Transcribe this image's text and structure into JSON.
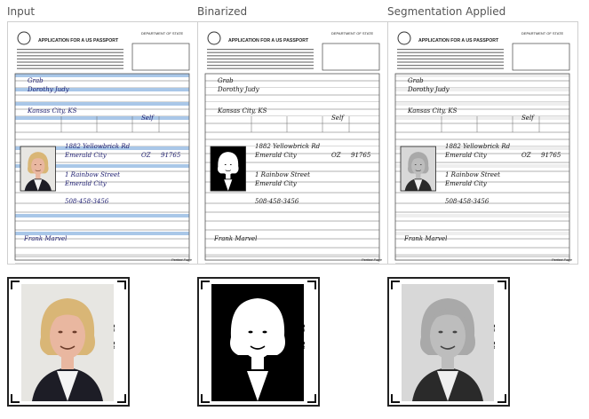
{
  "panels": [
    {
      "title": "Input",
      "mode": "input"
    },
    {
      "title": "Binarized",
      "mode": "binarized"
    },
    {
      "title": "Segmentation Applied",
      "mode": "segmented"
    }
  ],
  "form": {
    "header": "APPLICATION FOR A US PASSPORT",
    "department": "DEPARTMENT OF STATE",
    "surname": "Grab",
    "given_name": "Dorothy Judy",
    "birth_city": "Kansas City, KS",
    "occupation": "Self",
    "address_line": "1882 Yellowbrick Rd",
    "city": "Emerald City",
    "state": "OZ",
    "zip": "91765",
    "permanent_address": "1 Rainbow Street",
    "permanent_city": "Emerald City",
    "phone": "508-458-3456",
    "emergency_contact": "Frank Marvel",
    "footer": "Perfect Page"
  },
  "photo_size_label": "2\" x 2\"",
  "colors": {
    "form_blue": "#a9c7e8",
    "form_ink": "#1b1b6e"
  }
}
